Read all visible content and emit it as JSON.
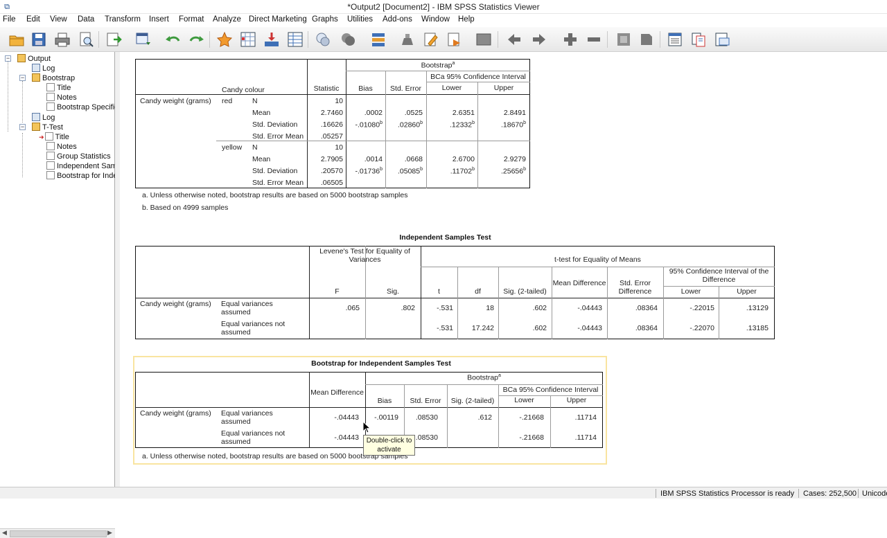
{
  "window": {
    "title": "*Output2 [Document2] - IBM SPSS Statistics Viewer"
  },
  "menu": [
    "File",
    "Edit",
    "View",
    "Data",
    "Transform",
    "Insert",
    "Format",
    "Analyze",
    "Direct Marketing",
    "Graphs",
    "Utilities",
    "Add-ons",
    "Window",
    "Help"
  ],
  "toolbar_icons": [
    "open-icon",
    "save-icon",
    "print-icon",
    "print-preview-icon",
    "export-icon",
    "dialog-recall-icon",
    "undo-icon",
    "redo-icon",
    "goto-data-icon",
    "goto-case-icon",
    "goto-variable-icon",
    "variables-icon",
    "designate-window-icon",
    "select-cases-icon",
    "split-icon",
    "weight-icon",
    "insert-heading-icon",
    "insert-title-icon",
    "insert-text-icon",
    "show-hide-icon",
    "promote-icon",
    "demote-icon",
    "expand-icon",
    "collapse-icon",
    "show-icon",
    "hide-icon",
    "insert-header-icon",
    "insert-page-break-icon",
    "insert-chart-icon"
  ],
  "nav": {
    "items": [
      {
        "label": "Output",
        "type": "book"
      },
      {
        "label": "Log",
        "type": "log"
      },
      {
        "label": "Bootstrap",
        "type": "book"
      },
      {
        "label": "Title",
        "type": "page"
      },
      {
        "label": "Notes",
        "type": "page"
      },
      {
        "label": "Bootstrap Specific",
        "type": "page"
      },
      {
        "label": "Log",
        "type": "log"
      },
      {
        "label": "T-Test",
        "type": "book"
      },
      {
        "label": "Title",
        "type": "page"
      },
      {
        "label": "Notes",
        "type": "page"
      },
      {
        "label": "Group Statistics",
        "type": "page"
      },
      {
        "label": "Independent Sam",
        "type": "page"
      },
      {
        "label": "Bootstrap for Inde",
        "type": "page"
      }
    ]
  },
  "table1": {
    "bootstrap_header": "Bootstrap",
    "bootstrap_sup": "a",
    "ci_header": "BCa 95% Confidence Interval",
    "col_group": "Candy colour",
    "cols": [
      "Statistic",
      "Bias",
      "Std. Error",
      "Lower",
      "Upper"
    ],
    "row_var": "Candy weight (grams)",
    "groups": [
      {
        "label": "red",
        "rows": [
          {
            "stat": "N",
            "v": [
              "10",
              "",
              "",
              "",
              ""
            ]
          },
          {
            "stat": "Mean",
            "v": [
              "2.7460",
              ".0002",
              ".0525",
              "2.6351",
              "2.8491"
            ]
          },
          {
            "stat": "Std. Deviation",
            "v": [
              ".16626",
              "-.01080b",
              ".02860b",
              ".12332b",
              ".18670b"
            ]
          },
          {
            "stat": "Std. Error Mean",
            "v": [
              ".05257",
              "",
              "",
              "",
              ""
            ]
          }
        ]
      },
      {
        "label": "yellow",
        "rows": [
          {
            "stat": "N",
            "v": [
              "10",
              "",
              "",
              "",
              ""
            ]
          },
          {
            "stat": "Mean",
            "v": [
              "2.7905",
              ".0014",
              ".0668",
              "2.6700",
              "2.9279"
            ]
          },
          {
            "stat": "Std. Deviation",
            "v": [
              ".20570",
              "-.01736b",
              ".05085b",
              ".11702b",
              ".25656b"
            ]
          },
          {
            "stat": "Std. Error Mean",
            "v": [
              ".06505",
              "",
              "",
              "",
              ""
            ]
          }
        ]
      }
    ],
    "notes": [
      "a. Unless otherwise noted, bootstrap results are based on 5000 bootstrap samples",
      "b. Based on 4999 samples"
    ]
  },
  "table2": {
    "caption": "Independent Samples Test",
    "levene": "Levene's Test for Equality of Variances",
    "ttest": "t-test for Equality of Means",
    "ci": "95% Confidence Interval of the Difference",
    "cols": [
      "F",
      "Sig.",
      "t",
      "df",
      "Sig. (2-tailed)",
      "Mean Difference",
      "Std. Error Difference",
      "Lower",
      "Upper"
    ],
    "row_var": "Candy weight (grams)",
    "rows": [
      {
        "label": "Equal variances assumed",
        "v": [
          ".065",
          ".802",
          "-.531",
          "18",
          ".602",
          "-.04443",
          ".08364",
          "-.22015",
          ".13129"
        ]
      },
      {
        "label": "Equal variances not assumed",
        "v": [
          "",
          "",
          "-.531",
          "17.242",
          ".602",
          "-.04443",
          ".08364",
          "-.22070",
          ".13185"
        ]
      }
    ]
  },
  "table3": {
    "caption": "Bootstrap for Independent Samples Test",
    "bootstrap_header": "Bootstrap",
    "bootstrap_sup": "a",
    "ci_header": "BCa 95% Confidence Interval",
    "cols": [
      "Mean Difference",
      "Bias",
      "Std. Error",
      "Sig. (2-tailed)",
      "Lower",
      "Upper"
    ],
    "row_var": "Candy weight (grams)",
    "rows": [
      {
        "label": "Equal variances assumed",
        "v": [
          "-.04443",
          "-.00119",
          ".08530",
          ".612",
          "-.21668",
          ".11714"
        ]
      },
      {
        "label": "Equal variances not assumed",
        "v": [
          "-.04443",
          "",
          ".08530",
          "",
          "-.21668",
          ".11714"
        ]
      }
    ],
    "note": "a. Unless otherwise noted, bootstrap results are based on 5000 bootstrap samples"
  },
  "tooltip": "Double-click to activate",
  "status": {
    "processor": "IBM SPSS Statistics Processor is ready",
    "cases": "Cases: 252,500",
    "encoding": "Unicode"
  }
}
